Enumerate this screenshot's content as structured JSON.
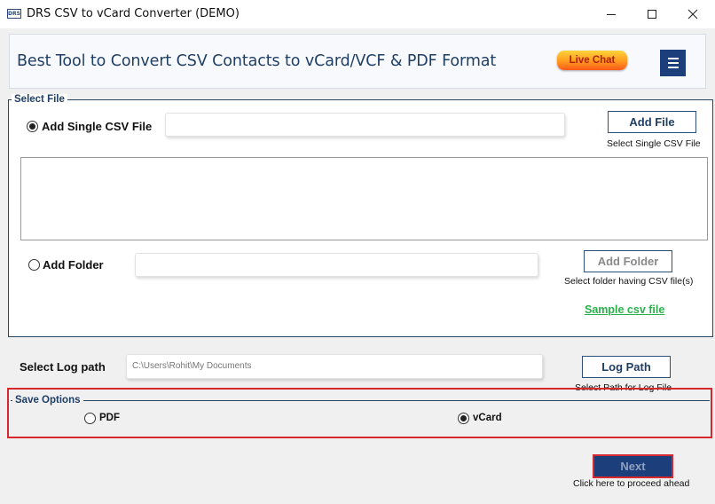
{
  "window": {
    "icon_text": "DRS",
    "title": "DRS CSV to vCard Converter (DEMO)",
    "controls": {
      "minimize": "—",
      "maximize": "☐",
      "close": "✕"
    }
  },
  "header": {
    "title": "Best Tool to Convert CSV Contacts to vCard/VCF & PDF Format",
    "live_chat": "Live Chat",
    "menu_icon": "hamburger-icon"
  },
  "select_file": {
    "legend": "Select File",
    "single_csv": {
      "label": "Add Single CSV File",
      "selected": true,
      "value": "",
      "button": "Add File",
      "hint": "Select Single CSV File"
    },
    "folder": {
      "label": "Add Folder",
      "selected": false,
      "value": "",
      "button": "Add Folder",
      "hint": "Select folder having CSV file(s)"
    },
    "sample_link": "Sample csv file"
  },
  "log_path": {
    "label": "Select Log path",
    "value": "C:\\Users\\Rohit\\My Documents",
    "button": "Log Path",
    "hint": "Select Path for Log File"
  },
  "save_options": {
    "legend": "Save Options",
    "options": [
      {
        "label": "PDF",
        "selected": false
      },
      {
        "label": "vCard",
        "selected": true
      }
    ]
  },
  "next": {
    "button": "Next",
    "hint": "Click here to proceed ahead"
  },
  "colors": {
    "brand_navy": "#1c3f7c",
    "highlight_red": "#d8282f",
    "link_green": "#28b24a",
    "live_chat_orange": "#ff9a1f"
  }
}
